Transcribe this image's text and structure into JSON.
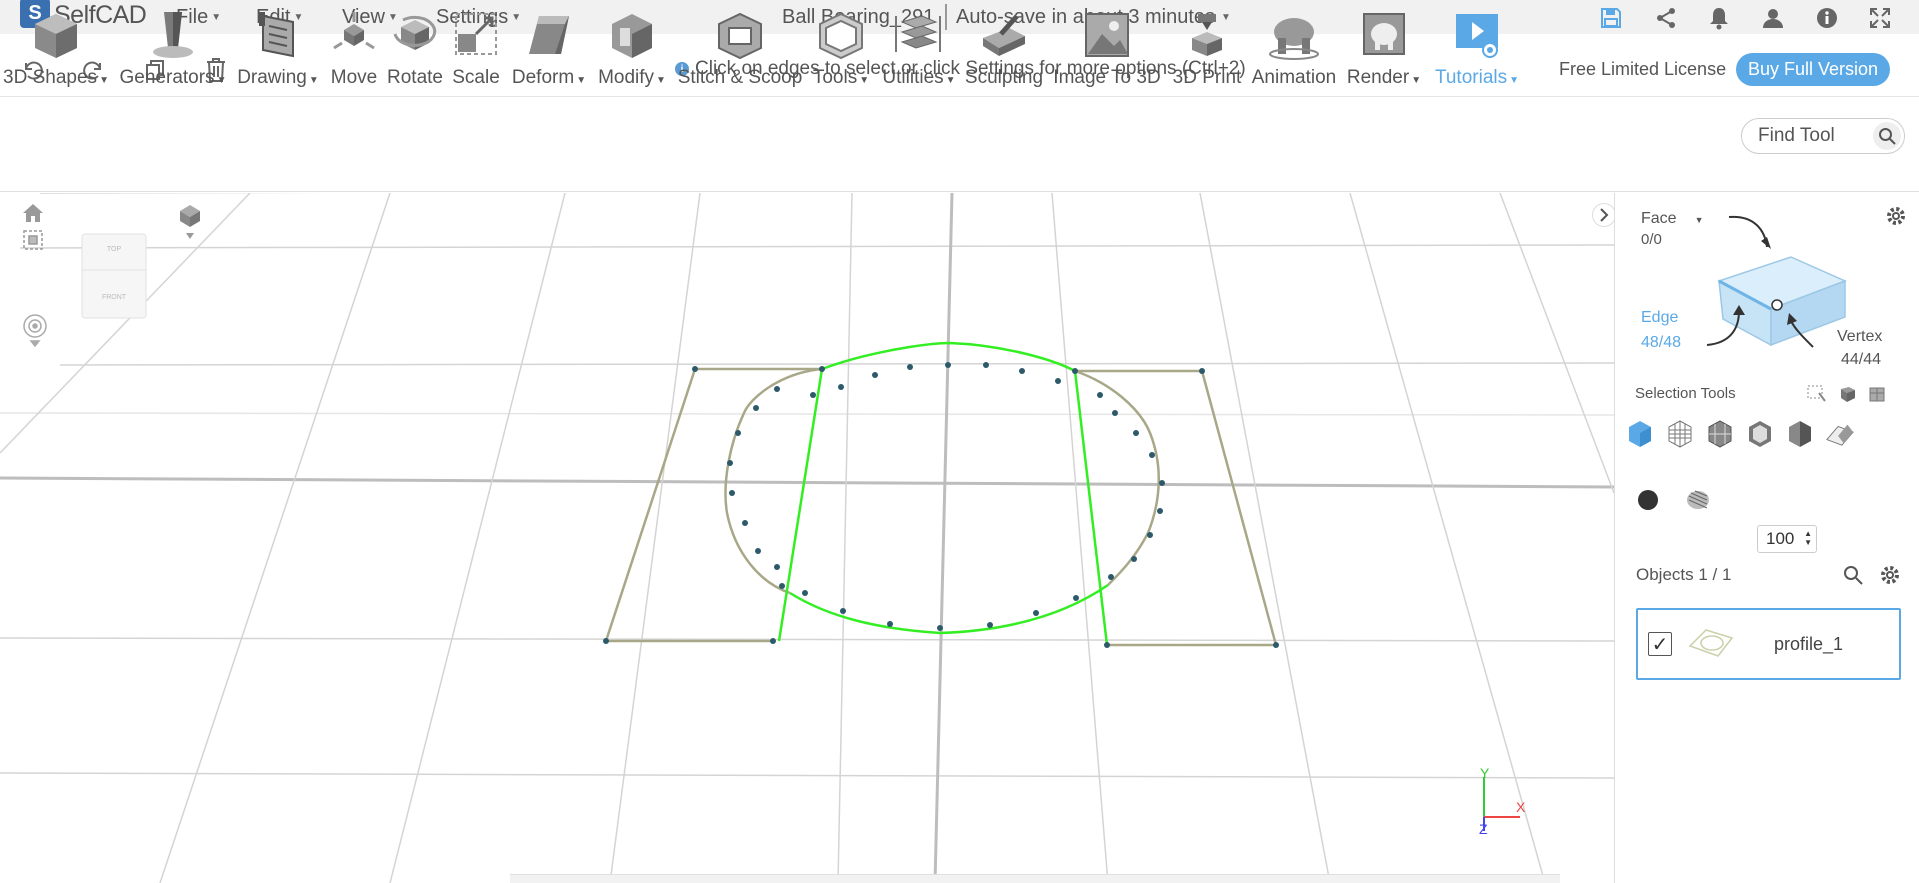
{
  "app": {
    "logo_letter": "S",
    "name": "SelfCAD"
  },
  "menu": {
    "file": "File",
    "edit": "Edit",
    "view": "View",
    "settings": "Settings"
  },
  "document": {
    "title": "Ball Bearing_291",
    "autosave": "Auto-save in about 3 minutes"
  },
  "actionbar": {
    "hint_icon": "i",
    "hint": "Click on edges to select or click Settings for more options (Ctrl+2)",
    "license": "Free Limited License",
    "buy_label": "Buy Full Version"
  },
  "ribbon": {
    "tools": [
      {
        "label": "3D Shapes",
        "icon": "cube-icon"
      },
      {
        "label": "Generators",
        "icon": "generators-icon"
      },
      {
        "label": "Drawing",
        "icon": "drawing-icon"
      },
      {
        "label": "Move",
        "icon": "move-icon"
      },
      {
        "label": "Rotate",
        "icon": "rotate-icon"
      },
      {
        "label": "Scale",
        "icon": "scale-icon"
      },
      {
        "label": "Deform",
        "icon": "deform-icon"
      },
      {
        "label": "Modify",
        "icon": "modify-icon"
      },
      {
        "label": "Stitch & Scoop",
        "icon": "stitch-scoop-icon"
      },
      {
        "label": "Tools",
        "icon": "tools-icon"
      },
      {
        "label": "Utilities",
        "icon": "utilities-icon"
      },
      {
        "label": "Sculpting",
        "icon": "sculpting-icon"
      },
      {
        "label": "Image To 3D",
        "icon": "image-to-3d-icon"
      },
      {
        "label": "3D Print",
        "icon": "3d-print-icon"
      },
      {
        "label": "Animation",
        "icon": "animation-icon"
      },
      {
        "label": "Render",
        "icon": "render-icon"
      },
      {
        "label": "Tutorials",
        "icon": "tutorials-icon"
      }
    ],
    "find_tool": "Find Tool"
  },
  "viewport": {
    "navcube_top": "TOP",
    "navcube_front": "FRONT",
    "axis_y": "Y",
    "axis_x": "X",
    "axis_z": "Z"
  },
  "panel": {
    "mode": "Face",
    "face_count": "0/0",
    "edge_label": "Edge",
    "edge_count": "48/48",
    "vertex_label": "Vertex",
    "vertex_count": "44/44",
    "selection_tools": "Selection Tools",
    "opacity": "100",
    "objects_label": "Objects 1 / 1",
    "objects": [
      {
        "name": "profile_1",
        "checked": "✓"
      }
    ]
  },
  "colors": {
    "accent": "#5aa9e6",
    "selected_edges": "#33ee22",
    "profile_edges": "#a8a888",
    "grid": "#cccccc"
  }
}
